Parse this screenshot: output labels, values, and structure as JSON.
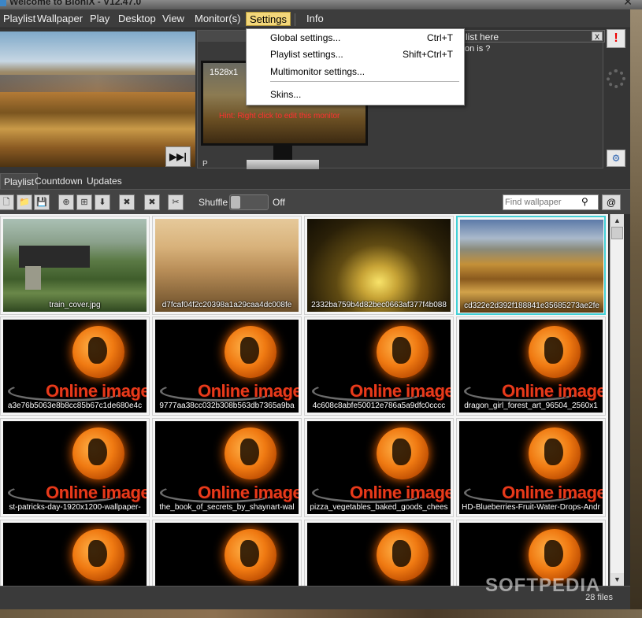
{
  "window": {
    "title": "Welcome to BioniX - V12.47.0"
  },
  "menubar": {
    "items": [
      "Playlist",
      "Wallpaper",
      "Play",
      "Desktop",
      "View",
      "Monitor(s)",
      "Settings",
      "Info"
    ]
  },
  "settings_menu": {
    "items": [
      {
        "label": "Global settings...",
        "shortcut": "Ctrl+T"
      },
      {
        "label": "Playlist settings...",
        "shortcut": "Shift+Ctrl+T"
      },
      {
        "label": "Multimonitor settings...",
        "shortcut": ""
      },
      {
        "label": "Skins...",
        "shortcut": ""
      }
    ]
  },
  "monitor": {
    "resolution": "1528x1",
    "hint": "Hint: Right click to edit this monitor",
    "label": "P"
  },
  "notice": {
    "text": "list here",
    "sub": "on is ?",
    "close": "X"
  },
  "tabs": [
    "Playlist",
    "Countdown",
    "Updates"
  ],
  "toolbar": {
    "shuffle_label": "Shuffle",
    "shuffle_state": "Off",
    "search_placeholder": "Find wallpaper",
    "at_label": "@"
  },
  "grid": {
    "online_text": "Online image",
    "items": [
      {
        "name": "train_cover.jpg",
        "kind": "train"
      },
      {
        "name": "d7fcaf04f2c20398a1a29caa4dc008fe",
        "kind": "tuscany"
      },
      {
        "name": "2332ba759b4d82bec0663af377f4b088",
        "kind": "tunnel"
      },
      {
        "name": "cd322e2d392f188841e35685273ae2fe",
        "kind": "hills",
        "selected": true
      },
      {
        "name": "a3e76b5063e8b8cc85b67c1de680e4c",
        "kind": "online"
      },
      {
        "name": "9777aa38cc032b308b563db7365a9ba",
        "kind": "online"
      },
      {
        "name": "4c608c8abfe50012e786a5a9dfc0cccc",
        "kind": "online"
      },
      {
        "name": "dragon_girl_forest_art_96504_2560x1",
        "kind": "online"
      },
      {
        "name": "st-patricks-day-1920x1200-wallpaper-",
        "kind": "online"
      },
      {
        "name": "the_book_of_secrets_by_shaynart-wal",
        "kind": "online"
      },
      {
        "name": "pizza_vegetables_baked_goods_chees",
        "kind": "online"
      },
      {
        "name": "HD-Blueberries-Fruit-Water-Drops-Andr",
        "kind": "online"
      },
      {
        "name": "",
        "kind": "online"
      },
      {
        "name": "",
        "kind": "online"
      },
      {
        "name": "",
        "kind": "online"
      },
      {
        "name": "",
        "kind": "online"
      }
    ]
  },
  "status": {
    "file_count": "28 files"
  },
  "watermark": "SOFTPEDIA",
  "colors": {
    "selection": "#42d0d6",
    "menu_active": "#f3d77a",
    "hint": "#ff3030"
  }
}
